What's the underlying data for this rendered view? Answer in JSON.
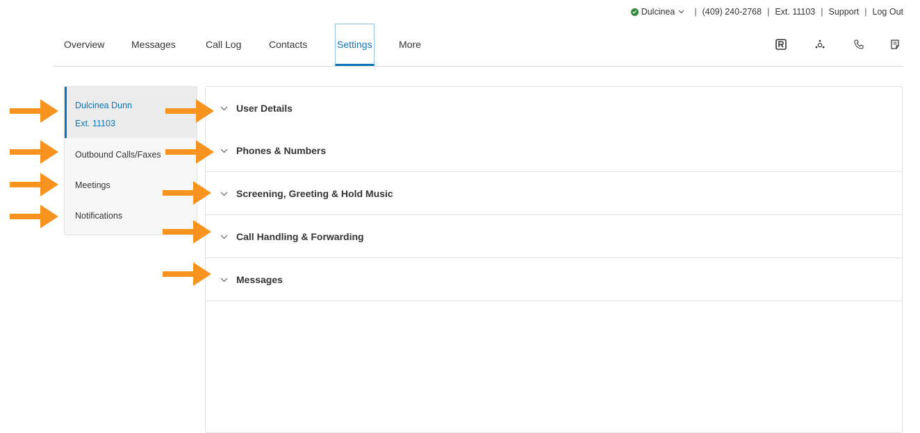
{
  "topbar": {
    "user_name": "Dulcinea",
    "phone": "(409) 240-2768",
    "extension": "Ext. 11103",
    "support": "Support",
    "logout": "Log Out",
    "separator": "|"
  },
  "nav": {
    "tabs": [
      {
        "label": "Overview"
      },
      {
        "label": "Messages"
      },
      {
        "label": "Call Log"
      },
      {
        "label": "Contacts"
      },
      {
        "label": "Settings",
        "active": true
      },
      {
        "label": "More"
      }
    ],
    "icons": [
      "r-app-icon",
      "network-icon",
      "phone-icon",
      "notes-icon"
    ]
  },
  "sidebar": {
    "user": {
      "name": "Dulcinea Dunn",
      "ext": "Ext. 11103"
    },
    "items": [
      {
        "label": "Outbound Calls/Faxes"
      },
      {
        "label": "Meetings"
      },
      {
        "label": "Notifications"
      }
    ]
  },
  "sections": [
    {
      "label": "User Details"
    },
    {
      "label": "Phones & Numbers"
    },
    {
      "label": "Screening, Greeting & Hold Music"
    },
    {
      "label": "Call Handling & Forwarding"
    },
    {
      "label": "Messages"
    }
  ],
  "colors": {
    "accent": "#0d73b8",
    "arrow": "#f7931e",
    "status_online": "#2e8b3a"
  }
}
